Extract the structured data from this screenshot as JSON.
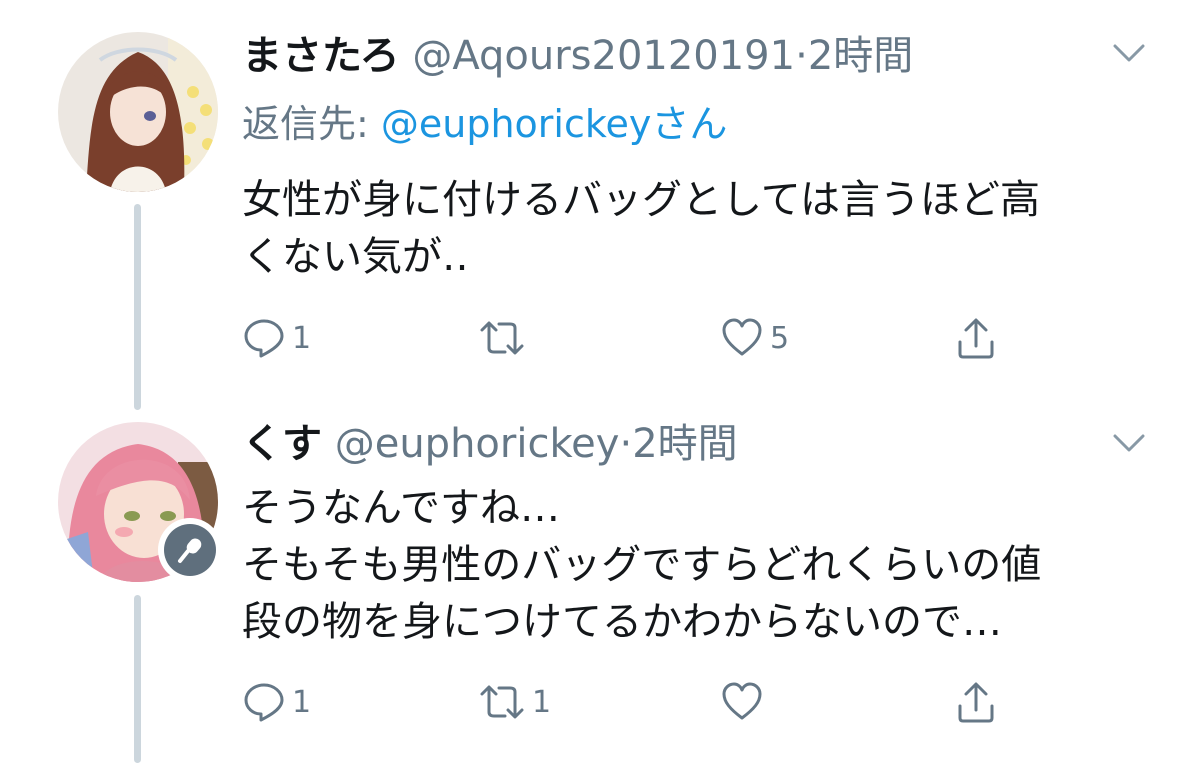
{
  "tweets": [
    {
      "display_name": "まさたろ",
      "handle": "@Aqours20120191",
      "separator": "·",
      "time": "2時間",
      "reply_label": "返信先: ",
      "reply_mention": "@euphorickey",
      "reply_suffix": "さん",
      "body_lines": [
        "女性が身に付けるバッグとしては言うほど高",
        "くない気が‥"
      ],
      "replies": "1",
      "retweets": "",
      "likes": "5"
    },
    {
      "display_name": "くす",
      "handle": "@euphorickey",
      "separator": "·",
      "time": "2時間",
      "body_lines": [
        "そうなんですね…",
        "そもそも男性のバッグですらどれくらいの値",
        "段の物を身につけてるかわからないので…"
      ],
      "replies": "1",
      "retweets": "1",
      "likes": ""
    }
  ],
  "icons": {
    "reply": "reply-icon",
    "retweet": "retweet-icon",
    "like": "heart-icon",
    "share": "share-icon",
    "more": "chevron-down-icon",
    "badge": "microphone-icon"
  },
  "colors": {
    "text": "#14171a",
    "secondary": "#657786",
    "link": "#1b95e0",
    "thread_line": "#ccd6dd",
    "badge": "#5f6f7d"
  }
}
